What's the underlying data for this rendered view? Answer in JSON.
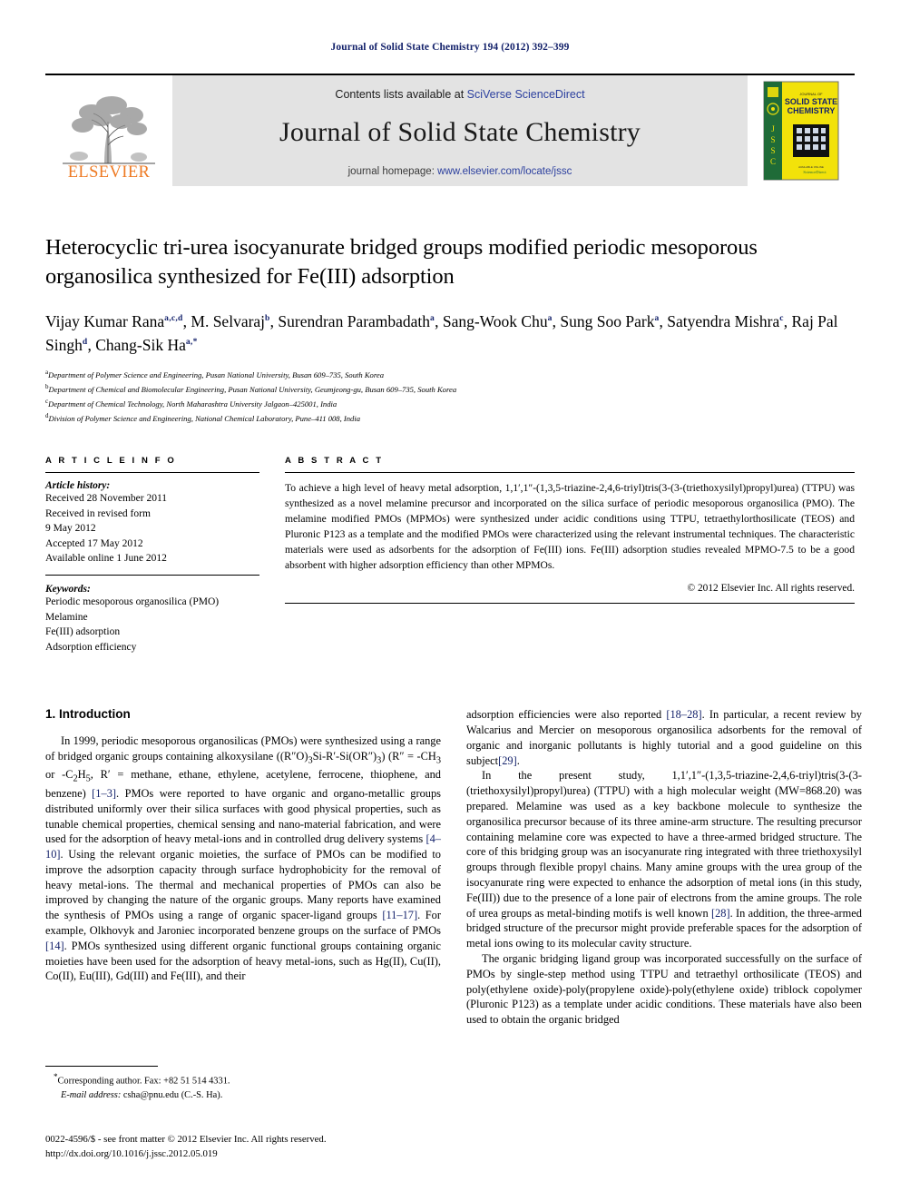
{
  "running_head": "Journal of Solid State Chemistry 194 (2012) 392–399",
  "masthead": {
    "contents_prefix": "Contents lists available at ",
    "sciencedirect": "SciVerse ScienceDirect",
    "journal_title": "Journal of Solid State Chemistry",
    "homepage_prefix": "journal homepage: ",
    "homepage_url": "www.elsevier.com/locate/jssc",
    "publisher_name": "ELSEVIER",
    "publisher_color": "#ee7a23",
    "cover": {
      "title_small": "JOURNAL OF",
      "title_line1": "SOLID STATE",
      "title_line2": "CHEMISTRY",
      "spine_text": "JSSC",
      "cover_bg": "#f2e20a",
      "spine_bg": "#1f6b38"
    }
  },
  "article": {
    "title": "Heterocyclic tri-urea isocyanurate bridged groups modified periodic mesoporous organosilica synthesized for Fe(III) adsorption",
    "authors": [
      {
        "name": "Vijay Kumar Rana",
        "sup": "a,c,d",
        "sep": ", "
      },
      {
        "name": "M. Selvaraj",
        "sup": "b",
        "sep": ", "
      },
      {
        "name": "Surendran Parambadath",
        "sup": "a",
        "sep": ", "
      },
      {
        "name": "Sang-Wook Chu",
        "sup": "a",
        "sep": ", "
      },
      {
        "name": "Sung Soo Park",
        "sup": "a",
        "sep": ", "
      },
      {
        "name": "Satyendra Mishra",
        "sup": "c",
        "sep": ", "
      },
      {
        "name": "Raj Pal Singh",
        "sup": "d",
        "sep": ", "
      },
      {
        "name": "Chang-Sik Ha",
        "sup": "a,*",
        "sep": ""
      }
    ],
    "affiliations": [
      {
        "mark": "a",
        "text": "Department of Polymer Science and Engineering, Pusan National University, Busan 609–735, South Korea"
      },
      {
        "mark": "b",
        "text": "Department of Chemical and Biomolecular Engineering, Pusan National University, Geumjeong-gu, Busan 609–735, South Korea"
      },
      {
        "mark": "c",
        "text": "Department of Chemical Technology, North Maharashtra University Jalgaon–425001, India"
      },
      {
        "mark": "d",
        "text": "Division of Polymer Science and Engineering, National Chemical Laboratory, Pune–411 008, India"
      }
    ]
  },
  "article_info": {
    "heading": "A R T I C L E   I N F O",
    "history_label": "Article history:",
    "history": [
      "Received 28 November 2011",
      "Received in revised form",
      "9 May 2012",
      "Accepted 17 May 2012",
      "Available online 1 June 2012"
    ],
    "keywords_label": "Keywords:",
    "keywords": [
      "Periodic mesoporous organosilica (PMO)",
      "Melamine",
      "Fe(III) adsorption",
      "Adsorption efficiency"
    ]
  },
  "abstract": {
    "heading": "A B S T R A C T",
    "text": "To achieve a high level of heavy metal adsorption, 1,1′,1″-(1,3,5-triazine-2,4,6-triyl)tris(3-(3-(triethoxysilyl)propyl)urea) (TTPU) was synthesized as a novel melamine precursor and incorporated on the silica surface of periodic mesoporous organosilica (PMO). The melamine modified PMOs (MPMOs) were synthesized under acidic conditions using TTPU, tetraethylorthosilicate (TEOS) and Pluronic P123 as a template and the modified PMOs were characterized using the relevant instrumental techniques. The characteristic materials were used as adsorbents for the adsorption of Fe(III) ions. Fe(III) adsorption studies revealed MPMO-7.5 to be a good absorbent with higher adsorption efficiency than other MPMOs.",
    "copyright": "© 2012 Elsevier Inc. All rights reserved."
  },
  "body": {
    "section_number_title": "1.  Introduction",
    "left_paragraphs": [
      {
        "runs": [
          {
            "t": "In 1999, periodic mesoporous organosilicas (PMOs) were synthesized using a range of bridged organic groups containing alkoxysilane ((R″O)",
            "c": false
          },
          {
            "t": "3",
            "c": false,
            "sub": true
          },
          {
            "t": "Si-R′-Si(OR″)",
            "c": false
          },
          {
            "t": "3",
            "c": false,
            "sub": true
          },
          {
            "t": ") (R″ = -CH",
            "c": false
          },
          {
            "t": "3",
            "c": false,
            "sub": true
          },
          {
            "t": " or -C",
            "c": false
          },
          {
            "t": "2",
            "c": false,
            "sub": true
          },
          {
            "t": "H",
            "c": false
          },
          {
            "t": "5",
            "c": false,
            "sub": true
          },
          {
            "t": ", R′ = methane, ethane, ethylene, acetylene, ferrocene, thiophene, and benzene) ",
            "c": false
          },
          {
            "t": "[1–3]",
            "c": true
          },
          {
            "t": ". PMOs were reported to have organic and organo-metallic groups distributed uniformly over their silica surfaces with good physical properties, such as tunable chemical properties, chemical sensing and nano-material fabrication, and were used for the adsorption of heavy metal-ions and in controlled drug delivery systems ",
            "c": false
          },
          {
            "t": "[4–10]",
            "c": true
          },
          {
            "t": ". Using the relevant organic moieties, the surface of PMOs can be modified to improve the adsorption capacity through surface hydrophobicity for the removal of heavy metal-ions. The thermal and mechanical properties of PMOs can also be improved by changing the nature of the organic groups. Many reports have examined the synthesis of PMOs using a range of organic spacer-ligand groups ",
            "c": false
          },
          {
            "t": "[11–17]",
            "c": true
          },
          {
            "t": ". For example, Olkhovyk and Jaroniec incorporated benzene groups on the surface of PMOs ",
            "c": false
          },
          {
            "t": "[14]",
            "c": true
          },
          {
            "t": ". PMOs synthesized using different organic functional groups containing organic moieties have been used for the adsorption of heavy metal-ions, such as Hg(II), Cu(II), Co(II), Eu(III), Gd(III) and Fe(III), and their",
            "c": false
          }
        ]
      }
    ],
    "right_paragraphs": [
      {
        "indent": false,
        "runs": [
          {
            "t": "adsorption efficiencies were also reported ",
            "c": false
          },
          {
            "t": "[18–28]",
            "c": true
          },
          {
            "t": ". In particular, a recent review by Walcarius and Mercier on mesoporous organosilica adsorbents for the removal of organic and inorganic pollutants is highly tutorial and a good guideline on this subject",
            "c": false
          },
          {
            "t": "[29]",
            "c": true
          },
          {
            "t": ".",
            "c": false
          }
        ]
      },
      {
        "indent": true,
        "runs": [
          {
            "t": "In the present study, 1,1′,1″-(1,3,5-triazine-2,4,6-triyl)tris(3-(3-(triethoxysilyl)propyl)urea) (TTPU) with a high molecular weight (MW=868.20) was prepared. Melamine was used as a key backbone molecule to synthesize the organosilica precursor because of its three amine-arm structure. The resulting precursor containing melamine core was expected to have a three-armed bridged structure. The core of this bridging group was an isocyanurate ring integrated with three triethoxysilyl groups through flexible propyl chains. Many amine groups with the urea group of the isocyanurate ring were expected to enhance the adsorption of metal ions (in this study, Fe(III)) due to the presence of a lone pair of electrons from the amine groups. The role of urea groups as metal-binding motifs is well known ",
            "c": false
          },
          {
            "t": "[28]",
            "c": true
          },
          {
            "t": ". In addition, the three-armed bridged structure of the precursor might provide preferable spaces for the adsorption of metal ions owing to its molecular cavity structure.",
            "c": false
          }
        ]
      },
      {
        "indent": true,
        "runs": [
          {
            "t": "The organic bridging ligand group was incorporated successfully on the surface of PMOs by single-step method using TTPU and tetraethyl orthosilicate (TEOS) and poly(ethylene oxide)-poly(propylene oxide)-poly(ethylene oxide) triblock copolymer (Pluronic P123) as a template under acidic conditions. These materials have also been used to obtain the organic bridged",
            "c": false
          }
        ]
      }
    ]
  },
  "footnotes": {
    "corresponding": "Corresponding author. Fax: +82 51 514 4331.",
    "email_label": "E-mail address:",
    "email_value": "csha@pnu.edu (C.-S. Ha).",
    "issn_line": "0022-4596/$ - see front matter © 2012 Elsevier Inc. All rights reserved.",
    "doi_line": "http://dx.doi.org/10.1016/j.jssc.2012.05.019"
  }
}
